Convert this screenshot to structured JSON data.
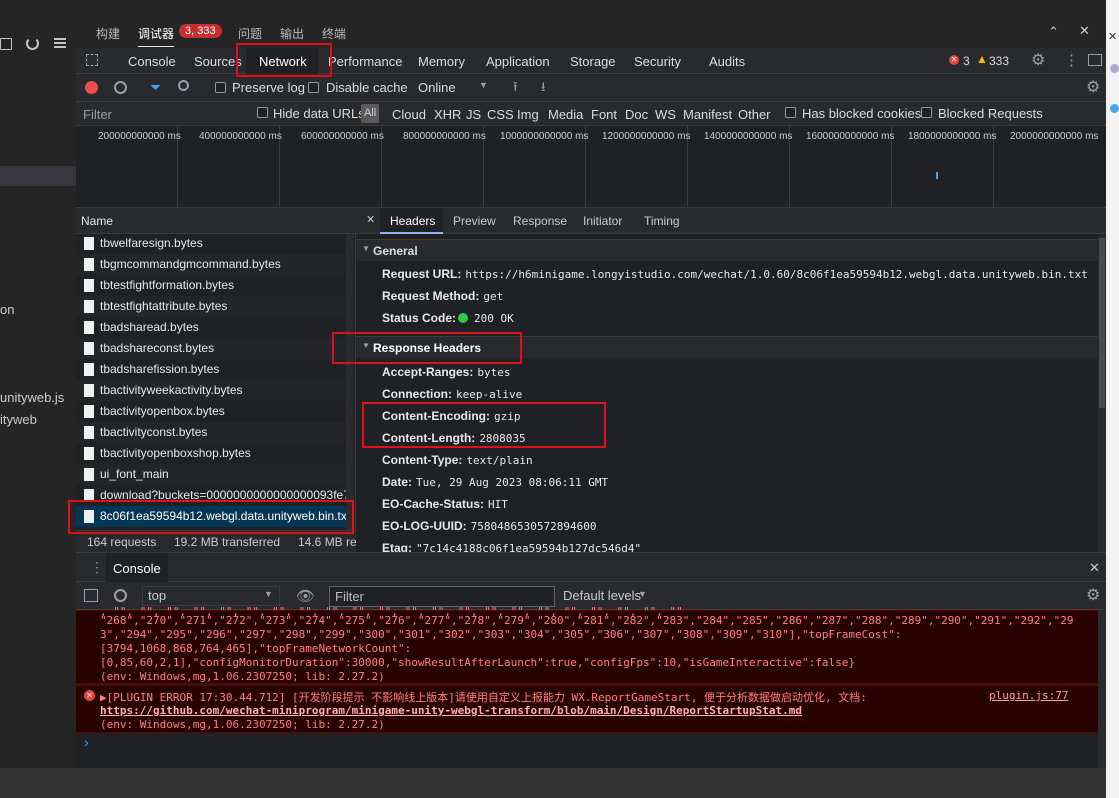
{
  "left_strip": {
    "items": [
      "on",
      "unityweb.js",
      "ityweb"
    ]
  },
  "panel_tabs": [
    {
      "label": "构建"
    },
    {
      "label": "调试器"
    },
    {
      "label": "问题"
    },
    {
      "label": "输出"
    },
    {
      "label": "终端"
    }
  ],
  "debugger_badge": "3, 333",
  "devtools_tabs": [
    "Console",
    "Sources",
    "Network",
    "Performance",
    "Memory",
    "Application",
    "Storage",
    "Security",
    "Audits"
  ],
  "status": {
    "errors": "3",
    "warnings": "333"
  },
  "toolbar": {
    "preserve_log": "Preserve log",
    "disable_cache": "Disable cache",
    "throttle": "Online"
  },
  "filterbar": {
    "filter_placeholder": "Filter",
    "hide_data_urls": "Hide data URLs",
    "types": [
      "All",
      "Cloud",
      "XHR",
      "JS",
      "CSS",
      "Img",
      "Media",
      "Font",
      "Doc",
      "WS",
      "Manifest",
      "Other"
    ],
    "has_blocked_cookies": "Has blocked cookies",
    "blocked_requests": "Blocked Requests"
  },
  "timeline": {
    "ticks": [
      "200000000000 ms",
      "400000000000 ms",
      "600000000000 ms",
      "800000000000 ms",
      "1000000000000 ms",
      "1200000000000 ms",
      "1400000000000 ms",
      "1600000000000 ms",
      "1800000000000 ms",
      "2000000000000 ms"
    ]
  },
  "request_list": {
    "header": "Name",
    "rows": [
      "tbwelfaresign.bytes",
      "tbgmcommandgmcommand.bytes",
      "tbtestfightformation.bytes",
      "tbtestfightattribute.bytes",
      "tbadsharead.bytes",
      "tbadshareconst.bytes",
      "tbadsharefission.bytes",
      "tbactivityweekactivity.bytes",
      "tbactivityopenbox.bytes",
      "tbactivityconst.bytes",
      "tbactivityopenboxshop.bytes",
      "ui_font_main",
      "download?buckets=0000000000000000093fe7...",
      "8c06f1ea59594b12.webgl.data.unityweb.bin.txt"
    ],
    "summary": [
      "164 requests",
      "19.2 MB transferred",
      "14.6 MB re"
    ]
  },
  "details": {
    "tabs": [
      "Headers",
      "Preview",
      "Response",
      "Initiator",
      "Timing"
    ],
    "general_title": "General",
    "general": [
      {
        "k": "Request URL:",
        "v": "https://h6minigame.longyistudio.com/wechat/1.0.60/8c06f1ea59594b12.webgl.data.unityweb.bin.txt"
      },
      {
        "k": "Request Method:",
        "v": "get"
      },
      {
        "k": "Status Code:",
        "v": "200 OK"
      }
    ],
    "response_title": "Response Headers",
    "response": [
      {
        "k": "Accept-Ranges:",
        "v": "bytes"
      },
      {
        "k": "Connection:",
        "v": "keep-alive"
      },
      {
        "k": "Content-Encoding:",
        "v": "gzip"
      },
      {
        "k": "Content-Length:",
        "v": "2808035"
      },
      {
        "k": "Content-Type:",
        "v": "text/plain"
      },
      {
        "k": "Date:",
        "v": "Tue, 29 Aug 2023 08:06:11 GMT"
      },
      {
        "k": "EO-Cache-Status:",
        "v": "HIT"
      },
      {
        "k": "EO-LOG-UUID:",
        "v": "7580486530572894600"
      },
      {
        "k": "Etag:",
        "v": "\"7c14c4188c06f1ea59594b127dc546d4\""
      }
    ]
  },
  "drawer": {
    "tab": "Console",
    "context": "top",
    "filter_placeholder": "Filter",
    "levels": "Default levels"
  },
  "console": {
    "log1": [
      "\"268\",\"270\",\"271\",\"272\",\"273\",\"274\",\"275\",\"276\",\"277\",\"278\",\"279\",\"280\",\"281\",\"282\",\"283\",\"284\",\"285\",\"286\",\"287\",\"288\",\"289\",\"290\",\"291\",\"292\",\"29",
      "3\",\"294\",\"295\",\"296\",\"297\",\"298\",\"299\",\"300\",\"301\",\"302\",\"303\",\"304\",\"305\",\"306\",\"307\",\"308\",\"309\",\"310\"],\"topFrameCost\":",
      "[3794,1068,868,764,465],\"topFrameNetworkCount\":",
      "[0,85,60,2,1],\"configMonitorDuration\":30000,\"showResultAfterLaunch\":true,\"configFps\":10,\"isGameInteractive\":false}",
      "(env: Windows,mg,1.06.2307250; lib: 2.27.2)"
    ],
    "error_msg": "▶[PLUGIN ERROR 17:30.44.712] [开发阶段提示 不影响线上版本]请使用自定义上报能力 WX.ReportGameStart, 便于分析数据做启动优化, 文档:",
    "error_source": "plugin.js:77",
    "error_link": "https://github.com/wechat-miniprogram/minigame-unity-webgl-transform/blob/main/Design/ReportStartupStat.md",
    "error_env": "(env: Windows,mg,1.06.2307250; lib: 2.27.2)",
    "prompt": "›"
  },
  "colors": {
    "accent_red": "#e0111a",
    "selected_row": "#073655",
    "status_green": "#2ecc40"
  }
}
